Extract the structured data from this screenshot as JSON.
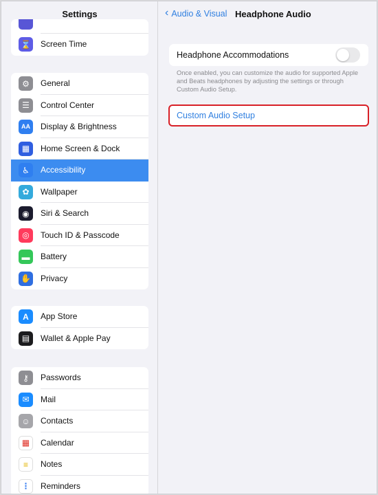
{
  "sidebar": {
    "title": "Settings",
    "groups": [
      [
        {
          "label": "",
          "icon": "partial-icon",
          "color": "#5856d6"
        },
        {
          "label": "Screen Time",
          "icon": "hourglass-icon",
          "color": "#5e5ce6"
        }
      ],
      [
        {
          "label": "General",
          "icon": "gear-icon",
          "color": "#8e8e93"
        },
        {
          "label": "Control Center",
          "icon": "toggles-icon",
          "color": "#8e8e93"
        },
        {
          "label": "Display & Brightness",
          "icon": "text-size-icon",
          "color": "#2f7ff0"
        },
        {
          "label": "Home Screen & Dock",
          "icon": "grid-icon",
          "color": "#2f5ee0"
        },
        {
          "label": "Accessibility",
          "icon": "accessibility-icon",
          "color": "#2f7ff0",
          "active": true
        },
        {
          "label": "Wallpaper",
          "icon": "flower-icon",
          "color": "#34aadc"
        },
        {
          "label": "Siri & Search",
          "icon": "siri-icon",
          "color": "#1c1c2e"
        },
        {
          "label": "Touch ID & Passcode",
          "icon": "fingerprint-icon",
          "color": "#ff3b5c"
        },
        {
          "label": "Battery",
          "icon": "battery-icon",
          "color": "#34c759"
        },
        {
          "label": "Privacy",
          "icon": "hand-icon",
          "color": "#2f6ee0"
        }
      ],
      [
        {
          "label": "App Store",
          "icon": "app-store-icon",
          "color": "#1a8cff"
        },
        {
          "label": "Wallet & Apple Pay",
          "icon": "wallet-icon",
          "color": "#1c1c1e"
        }
      ],
      [
        {
          "label": "Passwords",
          "icon": "key-icon",
          "color": "#8e8e93"
        },
        {
          "label": "Mail",
          "icon": "mail-icon",
          "color": "#1a8cff"
        },
        {
          "label": "Contacts",
          "icon": "contacts-icon",
          "color": "#a6a6aa"
        },
        {
          "label": "Calendar",
          "icon": "calendar-icon",
          "color": "#ffffff"
        },
        {
          "label": "Notes",
          "icon": "notes-icon",
          "color": "#ffffff"
        },
        {
          "label": "Reminders",
          "icon": "reminders-icon",
          "color": "#ffffff"
        }
      ]
    ]
  },
  "detail": {
    "back_label": "Audio & Visual",
    "title": "Headphone Audio",
    "accommodations_label": "Headphone Accommodations",
    "accommodations_on": false,
    "footnote": "Once enabled, you can customize the audio for supported Apple and Beats headphones by adjusting the settings or through Custom Audio Setup.",
    "custom_setup_label": "Custom Audio Setup"
  },
  "colors": {
    "accent": "#2f7fe0",
    "active_row": "#3c8cf0",
    "highlight": "#d81f26"
  }
}
